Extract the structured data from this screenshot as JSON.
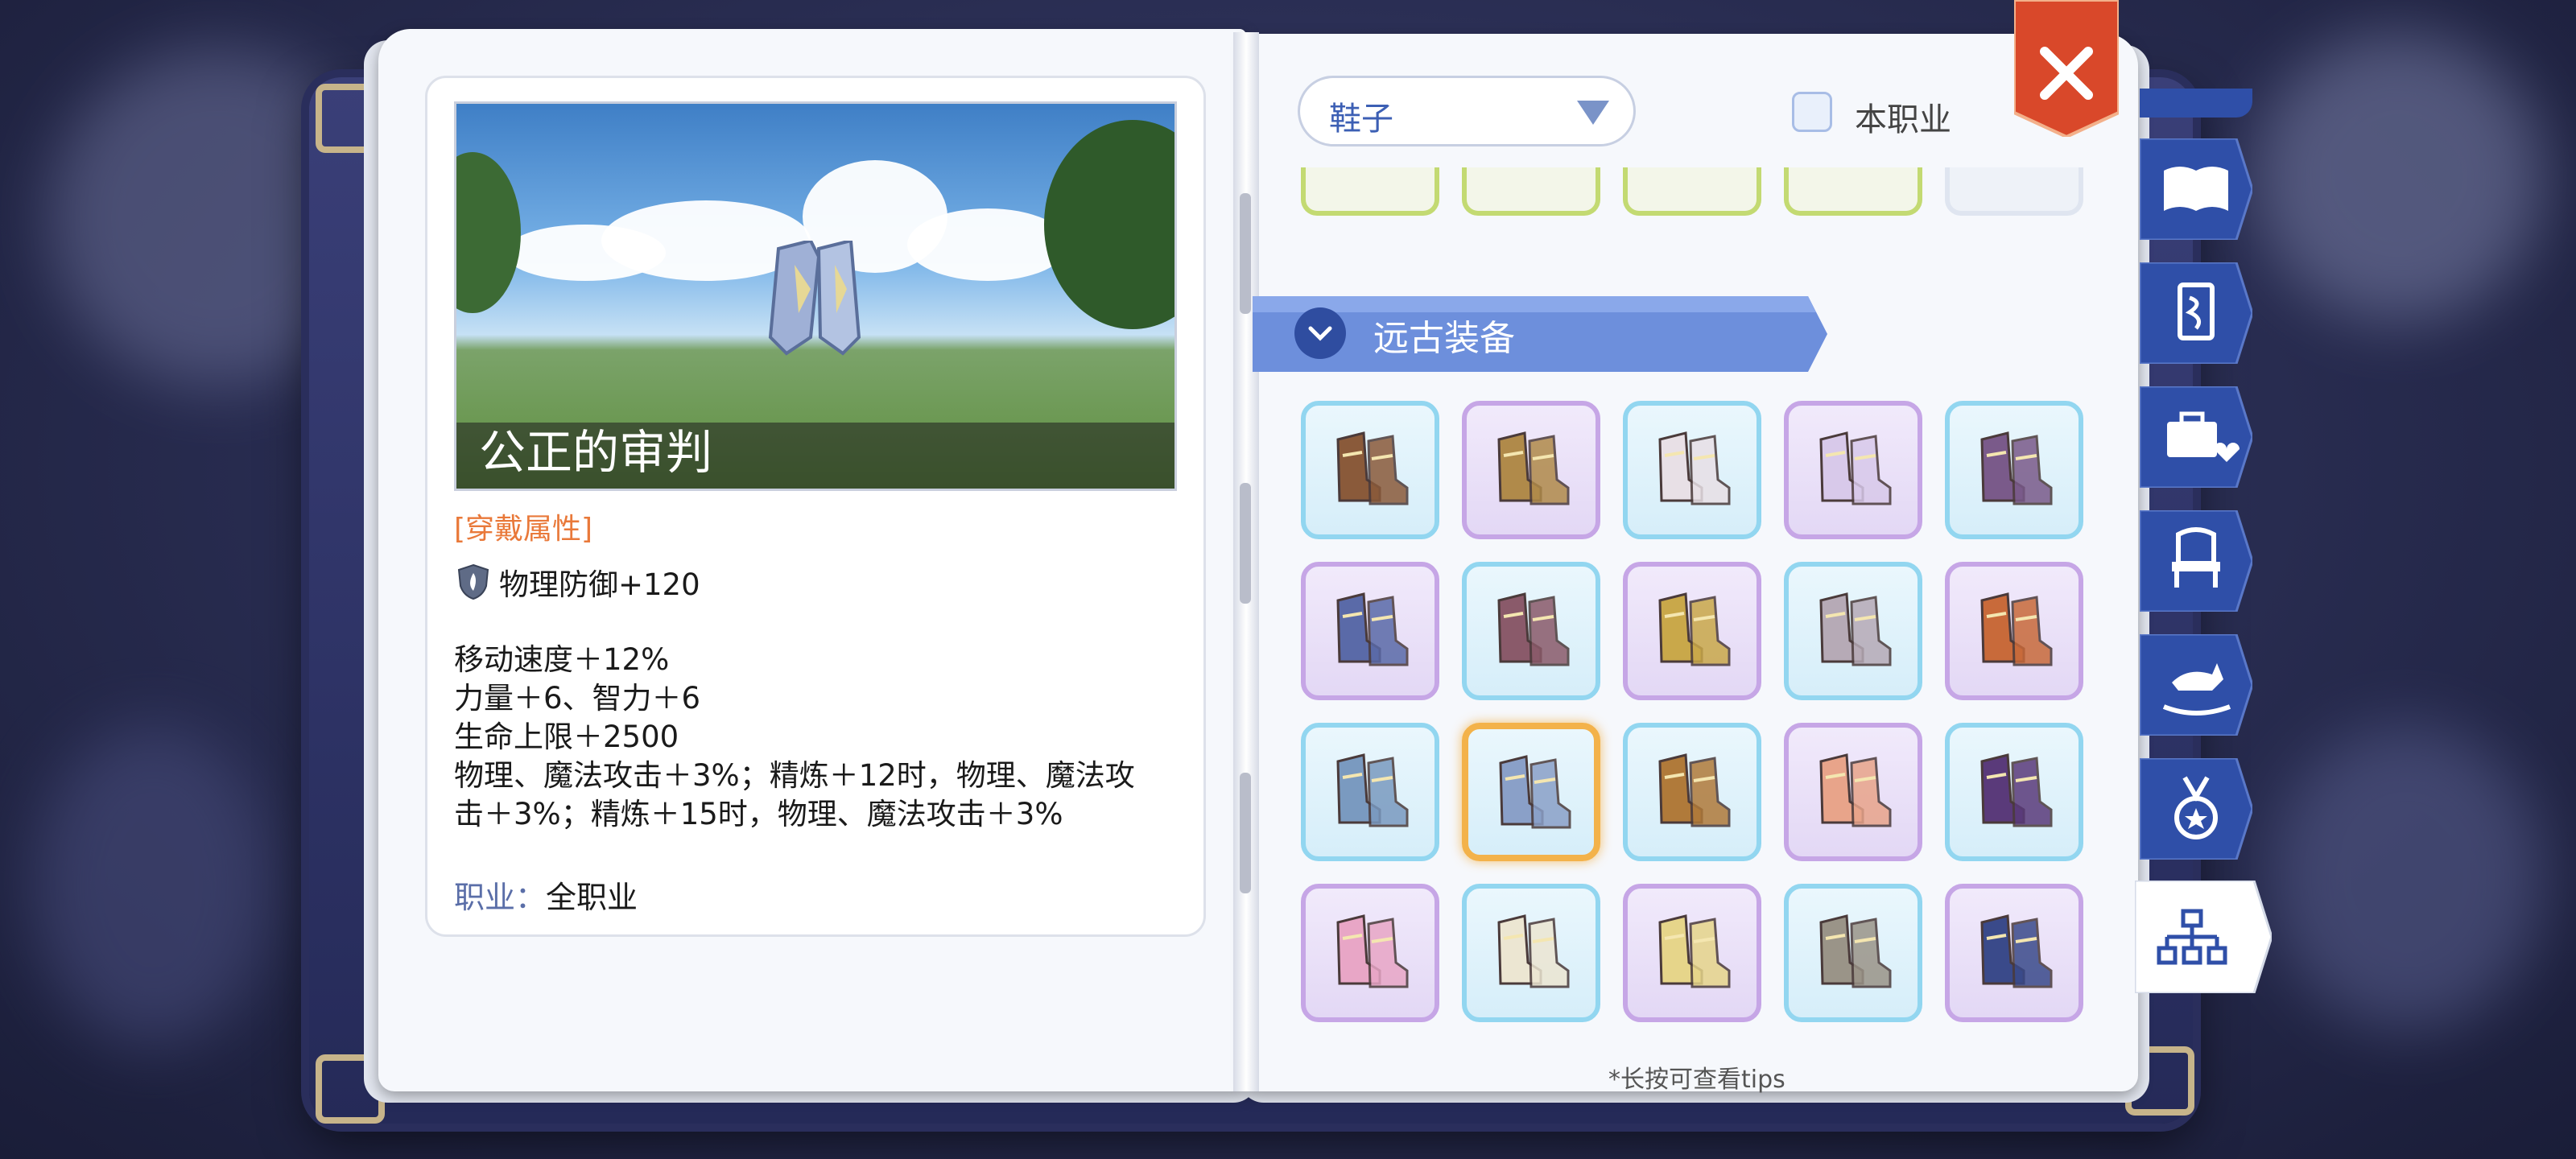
{
  "item": {
    "name": "公正的审判",
    "attr_header": "[穿戴属性]",
    "base_stat": "物理防御+120",
    "effects": [
      "移动速度＋12%",
      "力量＋6、智力＋6",
      "生命上限＋2500",
      "物理、魔法攻击＋3%；精炼＋12时，物理、魔法攻",
      "击＋3%；精炼＋15时，物理、魔法攻击＋3%"
    ],
    "job_label": "职业：",
    "job_value": "全职业"
  },
  "filter": {
    "dropdown_value": "鞋子",
    "checkbox_label": "本职业",
    "checkbox_checked": false
  },
  "section": {
    "title": "远古装备"
  },
  "grid": {
    "slots": [
      {
        "color": "blue",
        "icon": "boots-brown-icon",
        "tone": "#8a5a3a"
      },
      {
        "color": "purple",
        "icon": "boots-gold-icon",
        "tone": "#b08a4a"
      },
      {
        "color": "blue",
        "icon": "heels-white-icon",
        "tone": "#e8e0e6"
      },
      {
        "color": "purple",
        "icon": "heels-crystal-icon",
        "tone": "#d8c9ea"
      },
      {
        "color": "blue",
        "icon": "boots-violet-icon",
        "tone": "#7a5a8a"
      },
      {
        "color": "purple",
        "icon": "boots-blue-flame-icon",
        "tone": "#5a6aa8"
      },
      {
        "color": "blue",
        "icon": "boots-maroon-icon",
        "tone": "#8a5a6a"
      },
      {
        "color": "purple",
        "icon": "boots-gold-armor-icon",
        "tone": "#c9a84a"
      },
      {
        "color": "blue",
        "icon": "boots-silver-icon",
        "tone": "#b6aab6"
      },
      {
        "color": "purple",
        "icon": "boots-flame-icon",
        "tone": "#c86a3a"
      },
      {
        "color": "blue",
        "icon": "boots-ice-icon",
        "tone": "#7a9ac0"
      },
      {
        "color": "blue",
        "icon": "boots-judgment-icon",
        "tone": "#8aa0c8",
        "selected": true
      },
      {
        "color": "blue",
        "icon": "boots-tan-icon",
        "tone": "#b07a3a"
      },
      {
        "color": "purple",
        "icon": "boots-rose-icon",
        "tone": "#e8a48a"
      },
      {
        "color": "blue",
        "icon": "boots-dark-violet-icon",
        "tone": "#5a3a7a"
      },
      {
        "color": "purple",
        "icon": "boots-pink-icon",
        "tone": "#e8a6c6"
      },
      {
        "color": "blue",
        "icon": "heels-ivory-icon",
        "tone": "#ece6d2"
      },
      {
        "color": "purple",
        "icon": "heels-gold-icon",
        "tone": "#e6d58a"
      },
      {
        "color": "blue",
        "icon": "boots-grey-icon",
        "tone": "#9a9488"
      },
      {
        "color": "purple",
        "icon": "boots-navy-icon",
        "tone": "#3a4a8a"
      }
    ]
  },
  "hint": "*长按可查看tips",
  "side_tabs": [
    {
      "icon": "book-icon"
    },
    {
      "icon": "card-icon"
    },
    {
      "icon": "toolbox-icon"
    },
    {
      "icon": "chair-icon"
    },
    {
      "icon": "rocking-horse-icon"
    },
    {
      "icon": "medal-icon"
    },
    {
      "icon": "hierarchy-icon",
      "active": true
    }
  ],
  "colors": {
    "accent_orange": "#e9793a",
    "tab_blue": "#2f4fa8",
    "banner_blue": "#5a7ed4",
    "close_red": "#d9482a"
  }
}
